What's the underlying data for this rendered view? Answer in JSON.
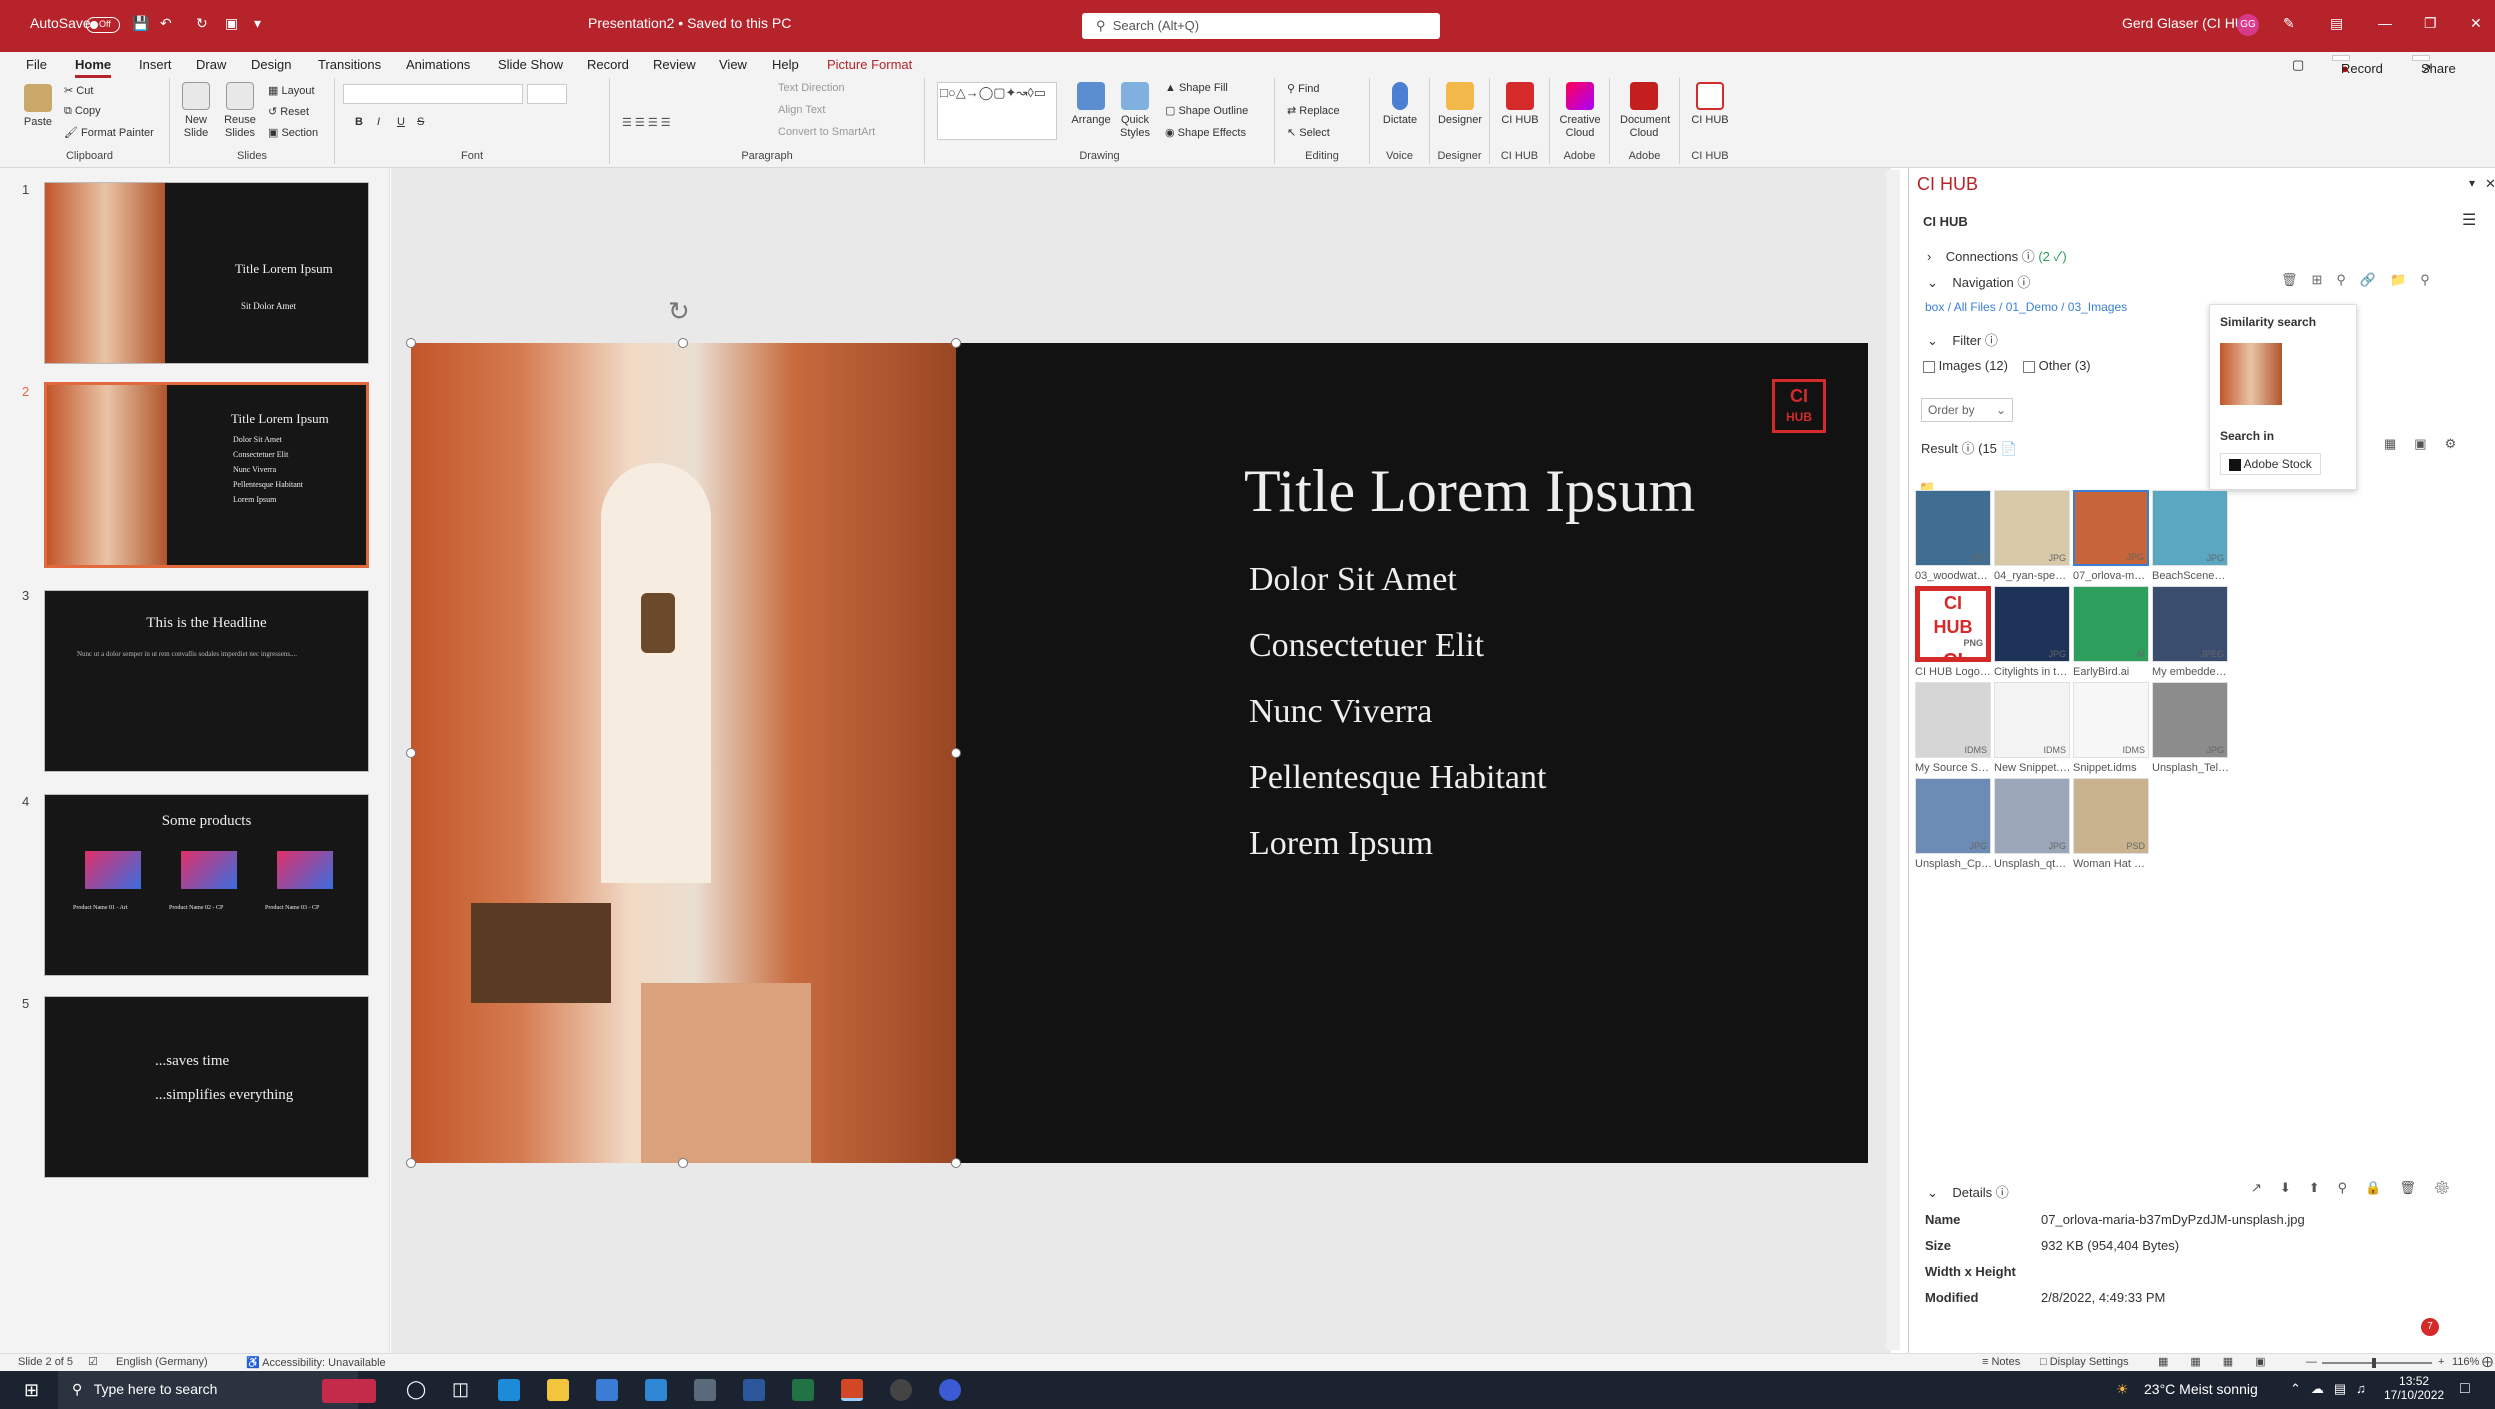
{
  "titlebar": {
    "autosave": "AutoSave",
    "autosave_state": "Off",
    "doc_title": "Presentation2 • Saved to this PC",
    "search_placeholder": "Search (Alt+Q)",
    "user": "Gerd Glaser (CI HUB)",
    "user_initials": "GG"
  },
  "tabs": [
    "File",
    "Home",
    "Insert",
    "Draw",
    "Design",
    "Transitions",
    "Animations",
    "Slide Show",
    "Record",
    "Review",
    "View",
    "Help",
    "Picture Format"
  ],
  "tab_actions": {
    "record": "Record",
    "share": "Share"
  },
  "ribbon": {
    "clipboard": {
      "paste": "Paste",
      "cut": "Cut",
      "copy": "Copy",
      "format_painter": "Format Painter",
      "label": "Clipboard"
    },
    "slides": {
      "new_slide": "New Slide",
      "reuse": "Reuse Slides",
      "layout": "Layout",
      "reset": "Reset",
      "section": "Section",
      "label": "Slides"
    },
    "font": {
      "label": "Font",
      "bold": "B",
      "italic": "I",
      "underline": "U",
      "strike": "S"
    },
    "paragraph": {
      "label": "Paragraph",
      "text_direction": "Text Direction",
      "align_text": "Align Text",
      "smartart": "Convert to SmartArt"
    },
    "drawing": {
      "label": "Drawing",
      "arrange": "Arrange",
      "quick_styles": "Quick Styles",
      "fill": "Shape Fill",
      "outline": "Shape Outline",
      "effects": "Shape Effects"
    },
    "editing": {
      "label": "Editing",
      "find": "Find",
      "replace": "Replace",
      "select": "Select"
    },
    "voice": {
      "label": "Voice",
      "dictate": "Dictate"
    },
    "designer": {
      "label": "Designer",
      "designer": "Designer"
    },
    "cihub1": {
      "label": "CI HUB",
      "name": "CI HUB"
    },
    "adobe1": {
      "label": "Adobe",
      "name": "Creative Cloud"
    },
    "adobe2": {
      "label": "Adobe",
      "name": "Document Cloud"
    },
    "cihub2": {
      "label": "CI HUB",
      "name": "CI HUB"
    }
  },
  "thumbnails": [
    {
      "num": "1",
      "title": "Title Lorem Ipsum",
      "sub": "Sit Dolor Amet"
    },
    {
      "num": "2",
      "title": "Title Lorem Ipsum",
      "lines": [
        "Dolor Sit Amet",
        "Consectetuer Elit",
        "Nunc Viverra",
        "Pellentesque Habitant",
        "Lorem Ipsum"
      ]
    },
    {
      "num": "3",
      "title": "This is the Headline",
      "body": "Nunc ut a dolor semper in ut rem convallis sodales imperdiet nec ingressens...."
    },
    {
      "num": "4",
      "title": "Some products",
      "captions": [
        "Product Name 01 - Art",
        "Product Name 02 - CP",
        "Product Name 03 - CP"
      ]
    },
    {
      "num": "5",
      "line1": "...saves time",
      "line2": "...simplifies everything"
    }
  ],
  "slide": {
    "title": "Title Lorem Ipsum",
    "bullets": [
      "Dolor Sit Amet",
      "Consectetuer Elit",
      "Nunc Viverra",
      "Pellentesque Habitant",
      "Lorem Ipsum"
    ],
    "logo_line1": "CI",
    "logo_line2": "HUB"
  },
  "cihub": {
    "header": "CI HUB",
    "panel_title": "CI HUB",
    "connections": "Connections",
    "connections_count": "(2 ✓)",
    "navigation": "Navigation",
    "breadcrumb": [
      "box",
      "All Files",
      "01_Demo",
      "03_Images"
    ],
    "filter": "Filter",
    "images_filter": "Images (12)",
    "other_filter": "Other (3)",
    "order_by": "Order by",
    "result": "Result",
    "result_count": "(15",
    "similarity_title": "Similarity search",
    "search_in": "Search in",
    "search_in_source": "Adobe Stock",
    "items": [
      {
        "name": "03_woodwatch--Hr_...",
        "ext": "JPG",
        "color": "#3f6e92"
      },
      {
        "name": "04_ryan-spencer-Wl...",
        "ext": "JPG",
        "color": "#d8c9a8"
      },
      {
        "name": "07_orlova-maria-b3...",
        "ext": "JPG",
        "color": "#c8643a"
      },
      {
        "name": "BeachScene_Versioni...",
        "ext": "JPG",
        "color": "#5aa7c2"
      },
      {
        "name": "CI HUB Logo red RG...",
        "ext": "PNG",
        "color": "#ffffff"
      },
      {
        "name": "Citylights in the nigh...",
        "ext": "JPG",
        "color": "#1d3358"
      },
      {
        "name": "EarlyBird.ai",
        "ext": "AI",
        "color": "#2e9e5c"
      },
      {
        "name": "My embedded imag...",
        "ext": "JPEG",
        "color": "#3a4d6e"
      },
      {
        "name": "My Source System.id...",
        "ext": "IDMS",
        "color": "#d6d6d6"
      },
      {
        "name": "New Snippet.idms",
        "ext": "IDMS",
        "color": "#f4f4f4"
      },
      {
        "name": "Snippet.idms",
        "ext": "IDMS",
        "color": "#f7f7f7"
      },
      {
        "name": "Unsplash_TeltYqgw2...",
        "ext": "JPG",
        "color": "#8c8c8c"
      },
      {
        "name": "Unsplash_CpdxeZA...",
        "ext": "JPG",
        "color": "#6d8cb5"
      },
      {
        "name": "Unsplash_qtFxWBk2...",
        "ext": "JPG",
        "color": "#9aa7b8"
      },
      {
        "name": "Woman Hat Layers.p...",
        "ext": "PSD",
        "color": "#c9b28e"
      }
    ],
    "details": "Details",
    "detail_rows": [
      {
        "k": "Name",
        "v": "07_orlova-maria-b37mDyPzdJM-unsplash.jpg"
      },
      {
        "k": "Size",
        "v": "932 KB (954,404 Bytes)"
      },
      {
        "k": "Width x Height",
        "v": ""
      },
      {
        "k": "Modified",
        "v": "2/8/2022, 4:49:33 PM"
      }
    ],
    "notif_count": "7"
  },
  "status": {
    "slide": "Slide 2 of 5",
    "lang": "English (Germany)",
    "accessibility": "Accessibility: Unavailable",
    "notes": "Notes",
    "display": "Display Settings",
    "zoom": "116%"
  },
  "taskbar": {
    "search": "Type here to search",
    "weather": "23°C  Meist sonnig",
    "time": "13:52",
    "date": "17/10/2022"
  },
  "colors": {
    "accent": "#b7232b",
    "selection": "#e2693b",
    "link": "#3b7fd4"
  }
}
